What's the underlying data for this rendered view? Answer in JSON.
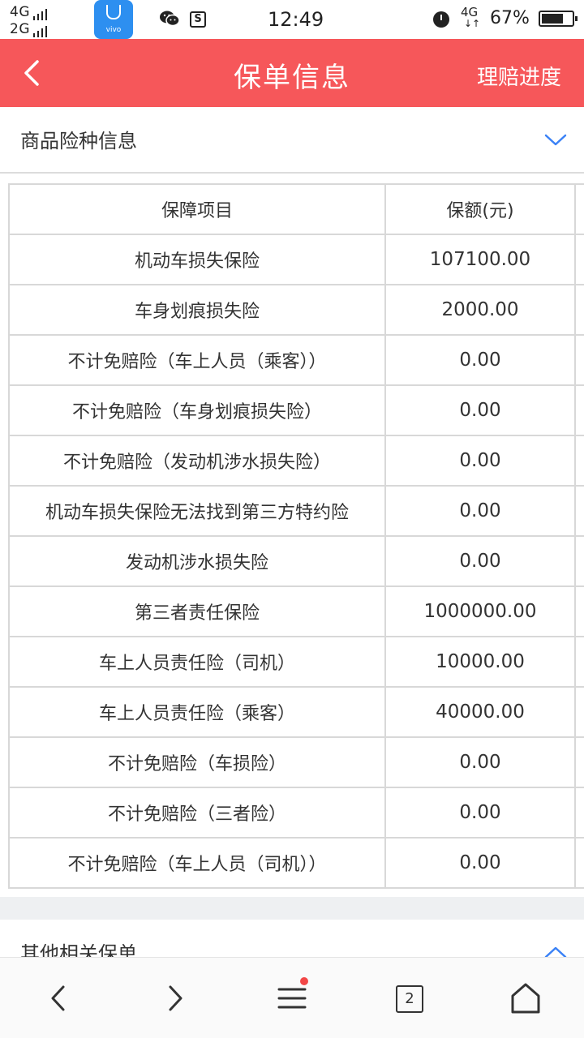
{
  "status_bar": {
    "signal_top": "4G",
    "signal_bottom": "2G",
    "app_icon_brand": "vivo",
    "time": "12:49",
    "network": "4G",
    "battery": "67%"
  },
  "header": {
    "title": "保单信息",
    "action_label": "理赔进度",
    "background_color": "#f6575a"
  },
  "section": {
    "title": "商品险种信息"
  },
  "table": {
    "headers": [
      "保障项目",
      "保额(元)"
    ],
    "rows": [
      {
        "item": "机动车损失保险",
        "amount": "107100.00"
      },
      {
        "item": "车身划痕损失险",
        "amount": "2000.00"
      },
      {
        "item": "不计免赔险（车上人员（乘客））",
        "amount": "0.00"
      },
      {
        "item": "不计免赔险（车身划痕损失险）",
        "amount": "0.00"
      },
      {
        "item": "不计免赔险（发动机涉水损失险）",
        "amount": "0.00"
      },
      {
        "item": "机动车损失保险无法找到第三方特约险",
        "amount": "0.00"
      },
      {
        "item": "发动机涉水损失险",
        "amount": "0.00"
      },
      {
        "item": "第三者责任保险",
        "amount": "1000000.00"
      },
      {
        "item": "车上人员责任险（司机）",
        "amount": "10000.00"
      },
      {
        "item": "车上人员责任险（乘客）",
        "amount": "40000.00"
      },
      {
        "item": "不计免赔险（车损险）",
        "amount": "0.00"
      },
      {
        "item": "不计免赔险（三者险）",
        "amount": "0.00"
      },
      {
        "item": "不计免赔险（车上人员（司机））",
        "amount": "0.00"
      }
    ]
  },
  "section2": {
    "title": "其他相关保单"
  },
  "bottom_nav": {
    "tabs_count": "2",
    "icons": [
      "back-icon",
      "forward-icon",
      "menu-icon",
      "tabs-icon",
      "home-icon"
    ]
  }
}
